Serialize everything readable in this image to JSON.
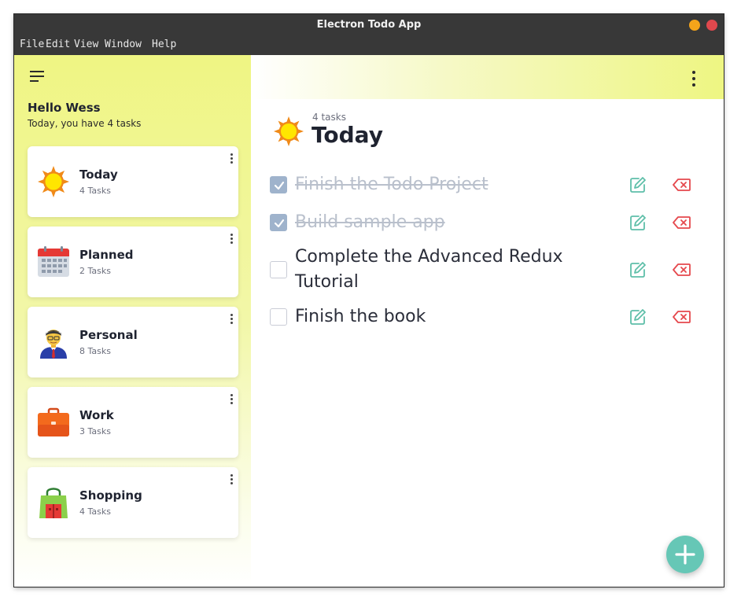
{
  "window": {
    "title": "Electron Todo App",
    "controls": {
      "minimize_color": "#f4a41a",
      "close_color": "#e0484d"
    }
  },
  "menubar": {
    "items": [
      "File",
      "Edit",
      "View",
      "Window",
      "Help"
    ]
  },
  "sidebar": {
    "greeting": "Hello Wess",
    "subtitle": "Today, you have 4 tasks",
    "lists": [
      {
        "name": "Today",
        "count": "4 Tasks",
        "icon": "sun-icon"
      },
      {
        "name": "Planned",
        "count": "2 Tasks",
        "icon": "calendar-icon"
      },
      {
        "name": "Personal",
        "count": "8 Tasks",
        "icon": "person-icon"
      },
      {
        "name": "Work",
        "count": "3 Tasks",
        "icon": "briefcase-icon"
      },
      {
        "name": "Shopping",
        "count": "4 Tasks",
        "icon": "shopping-bag-icon"
      }
    ]
  },
  "main": {
    "list_icon": "sun-icon",
    "task_count": "4 tasks",
    "list_title": "Today",
    "tasks": [
      {
        "text": "Finish the Todo Project",
        "done": true
      },
      {
        "text": "Build sample app",
        "done": true
      },
      {
        "text": "Complete the Advanced Redux Tutorial",
        "done": false
      },
      {
        "text": "Finish the book",
        "done": false
      }
    ]
  },
  "colors": {
    "accent": "#66c7b6",
    "delete": "#e5484d",
    "sidebar_top": "#eff583",
    "checkbox_checked": "#9fb3cc"
  }
}
